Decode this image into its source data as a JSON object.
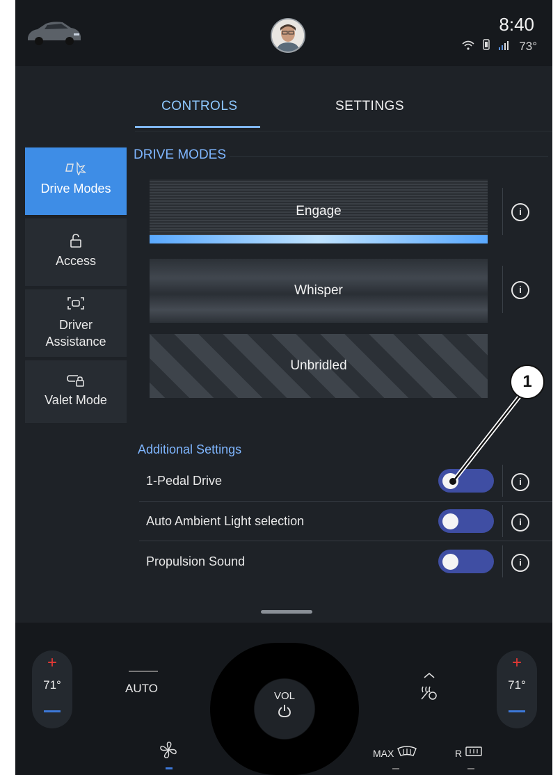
{
  "status": {
    "time": "8:40",
    "temperature": "73°"
  },
  "tabs": {
    "controls": "CONTROLS",
    "settings": "SETTINGS"
  },
  "nav": {
    "items": [
      {
        "label": "Drive Modes",
        "icon": "drive-modes-icon",
        "active": true
      },
      {
        "label": "Access",
        "icon": "lock-icon",
        "active": false
      },
      {
        "label": "Driver Assistance",
        "icon": "driver-assist-icon",
        "active": false
      },
      {
        "label": "Valet Mode",
        "icon": "valet-icon",
        "active": false
      }
    ]
  },
  "drive_modes": {
    "title": "DRIVE MODES",
    "modes": [
      "Engage",
      "Whisper",
      "Unbridled"
    ],
    "selected": "Engage"
  },
  "additional": {
    "title": "Additional Settings",
    "settings": [
      {
        "label": "1-Pedal Drive",
        "on": false
      },
      {
        "label": "Auto Ambient Light selection",
        "on": false
      },
      {
        "label": "Propulsion Sound",
        "on": false
      }
    ]
  },
  "callout": "1",
  "climate": {
    "left_temp": "71°",
    "right_temp": "71°",
    "auto": "AUTO",
    "vol": "VOL",
    "max_defrost": "MAX",
    "rear_defrost": "R"
  },
  "colors": {
    "accent": "#3e8de6",
    "tab_active": "#8ec8ff",
    "toggle_track": "#3f4ea3",
    "temp_up": "#e53935"
  }
}
